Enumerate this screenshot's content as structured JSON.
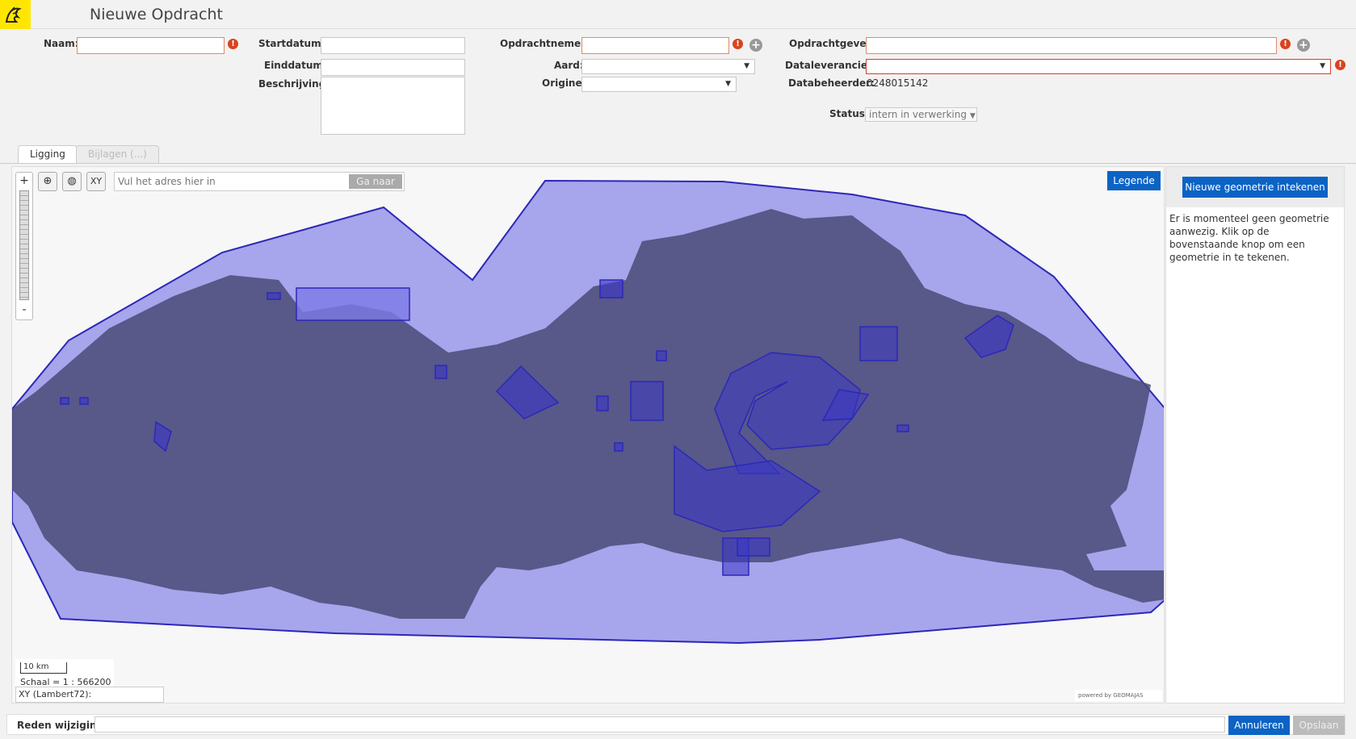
{
  "header": {
    "title": "Nieuwe Opdracht",
    "logo_icon": "lion-logo-icon"
  },
  "form": {
    "naam": {
      "label": "Naam:",
      "value": ""
    },
    "startdatum": {
      "label": "Startdatum:",
      "value": ""
    },
    "einddatum": {
      "label": "Einddatum:",
      "value": ""
    },
    "beschrijving": {
      "label": "Beschrijving:",
      "value": ""
    },
    "opdrachtnemer": {
      "label": "Opdrachtnemer:",
      "value": ""
    },
    "aard": {
      "label": "Aard:",
      "value": ""
    },
    "origine": {
      "label": "Origine:",
      "value": ""
    },
    "opdrachtgever": {
      "label": "Opdrachtgever:",
      "value": ""
    },
    "dataleverancier": {
      "label": "Dataleverancier:",
      "value": ""
    },
    "databeheerder": {
      "label": "Databeheerder:",
      "value": "0248015142"
    },
    "status": {
      "label": "Status:",
      "value": "intern in verwerking"
    },
    "required_icon": "!",
    "add_icon": "+"
  },
  "tabs": [
    {
      "label": "Ligging",
      "active": true
    },
    {
      "label": "Bijlagen (...)",
      "active": false
    }
  ],
  "map": {
    "zoom_in": "+",
    "zoom_out": "-",
    "xy_button": "XY",
    "address_placeholder": "Vul het adres hier in",
    "goto_label": "Ga naar",
    "legend_label": "Legende",
    "scale_bar": "10 km",
    "scale_text": "Schaal = 1 : 566200",
    "xy_readout": "XY (Lambert72):",
    "powered_by": "powered by GEOMAJAS",
    "fill_color": "#7d7ae6",
    "stroke_color": "#2c28b8",
    "land_color": "#4a4a78"
  },
  "side_panel": {
    "button_label": "Nieuwe geometrie intekenen",
    "message": "Er is momenteel geen geometrie aanwezig. Klik op de bovenstaande knop om een geometrie in te tekenen."
  },
  "footer": {
    "reden_label": "Reden wijziging:",
    "reden_value": "",
    "cancel_label": "Annuleren",
    "save_label": "Opslaan"
  },
  "colors": {
    "accent": "#0b63c5",
    "required": "#d9431e",
    "logo": "#ffe600"
  }
}
